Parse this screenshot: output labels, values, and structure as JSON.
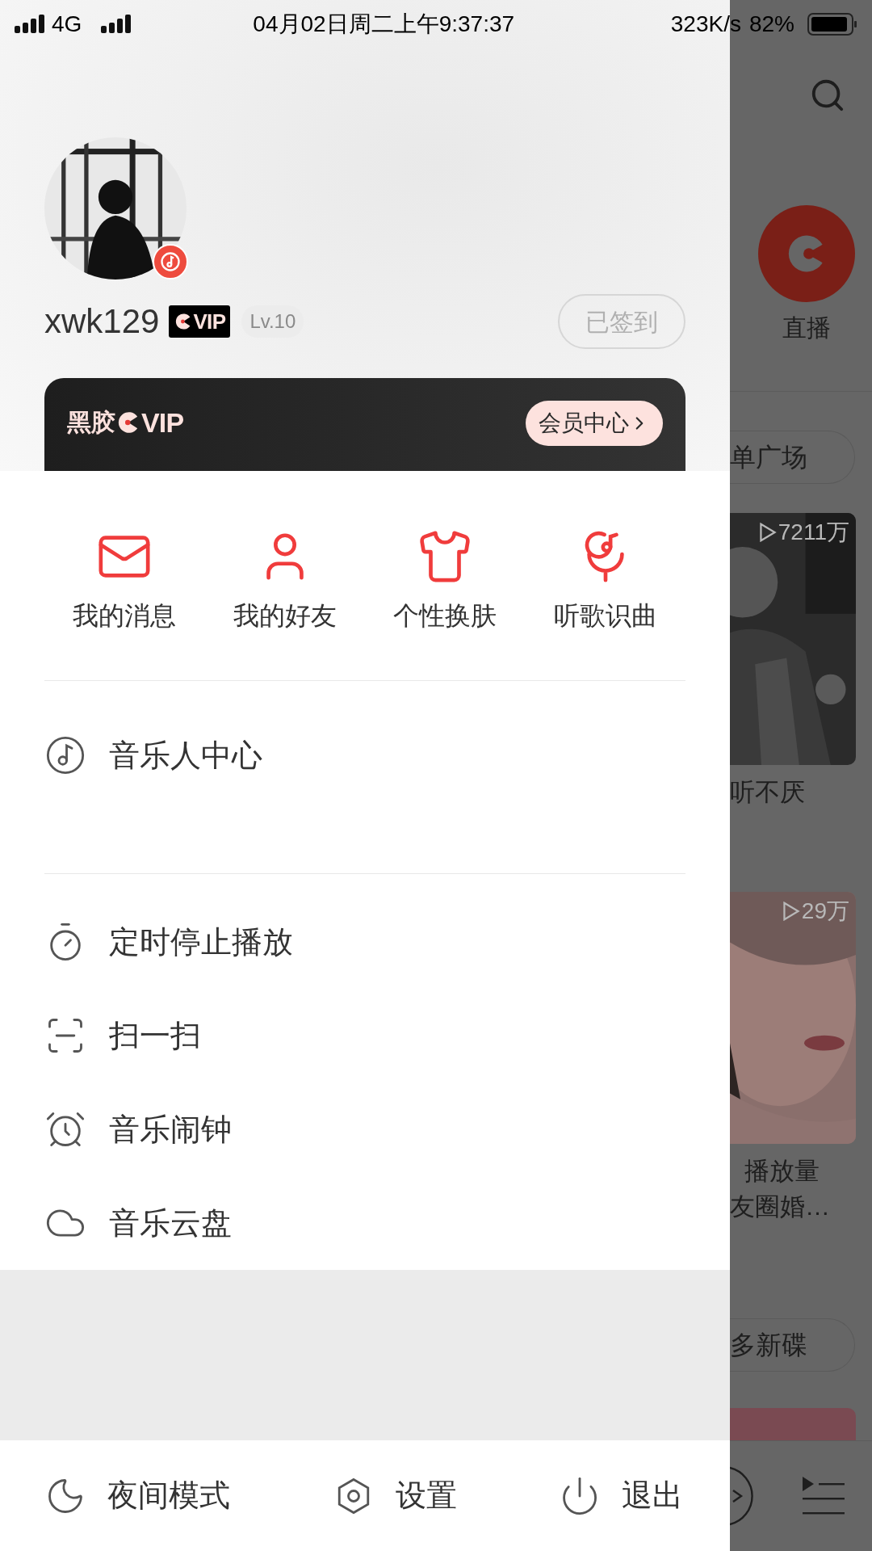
{
  "status_bar": {
    "network": "4G",
    "time": "04月02日周二上午9:37:37",
    "speed": "323K/s",
    "battery": "82%"
  },
  "profile": {
    "username": "xwk129",
    "vip_badge": "VIP",
    "level": "Lv.10",
    "sign_in": {
      "label": "已签到",
      "signed": true
    }
  },
  "vip_card": {
    "brand": "黑胶",
    "brand_suffix": "VIP",
    "button": "会员中心"
  },
  "quick_actions": [
    {
      "label": "我的消息",
      "kind": "mail"
    },
    {
      "label": "我的好友",
      "kind": "friend"
    },
    {
      "label": "个性换肤",
      "kind": "skin"
    },
    {
      "label": "听歌识曲",
      "kind": "recognize"
    }
  ],
  "menu_groups": [
    [
      {
        "label": "音乐人中心",
        "kind": "musician"
      }
    ],
    [
      {
        "label": "定时停止播放",
        "kind": "timer"
      },
      {
        "label": "扫一扫",
        "kind": "scan"
      },
      {
        "label": "音乐闹钟",
        "kind": "alarm"
      },
      {
        "label": "音乐云盘",
        "kind": "cloud"
      }
    ]
  ],
  "bottom_bar": [
    {
      "label": "夜间模式",
      "kind": "moon"
    },
    {
      "label": "设置",
      "kind": "settings"
    },
    {
      "label": "退出",
      "kind": "power"
    }
  ],
  "background_page": {
    "live_label": "直播",
    "playlist_square": "单广场",
    "cards": [
      {
        "plays": "7211万",
        "title_lines": [
          "听不厌"
        ]
      },
      {
        "plays": "29万",
        "title_lines": [
          "播放量",
          "友圈婚…"
        ]
      }
    ],
    "new_albums": "多新碟"
  }
}
